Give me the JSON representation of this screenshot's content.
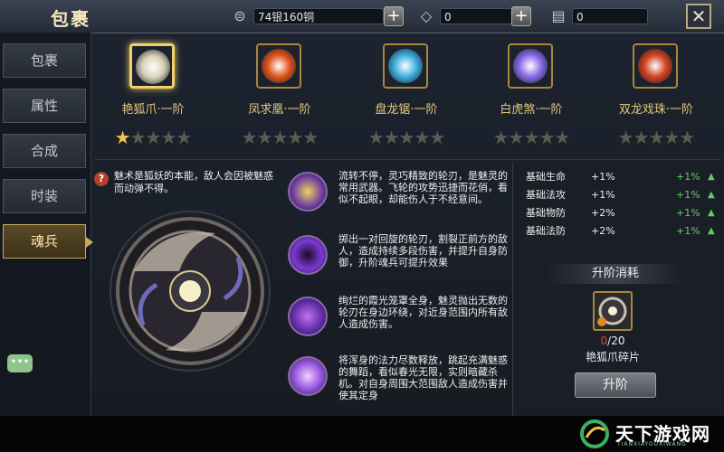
{
  "header": {
    "title": "包裹",
    "silver": "74银160铜",
    "gems": "0",
    "cards": "0"
  },
  "sidebar": {
    "items": [
      {
        "label": "包裹",
        "active": false
      },
      {
        "label": "属性",
        "active": false
      },
      {
        "label": "合成",
        "active": false
      },
      {
        "label": "时装",
        "active": false
      },
      {
        "label": "魂兵",
        "active": true
      }
    ]
  },
  "weapons": [
    {
      "name": "艳狐爪·一阶",
      "stars": 1,
      "selected": true,
      "color": "#d8d0b8"
    },
    {
      "name": "凤求凰·一阶",
      "stars": 0,
      "selected": false,
      "color": "#e0561d"
    },
    {
      "name": "盘龙锯·一阶",
      "stars": 0,
      "selected": false,
      "color": "#3fb0e0"
    },
    {
      "name": "白虎煞·一阶",
      "stars": 0,
      "selected": false,
      "color": "#8a6be8"
    },
    {
      "name": "双龙戏珠·一阶",
      "stars": 0,
      "selected": false,
      "color": "#d24422"
    }
  ],
  "description": "魅术是狐妖的本能，敌人会因被魅惑而动弹不得。",
  "skills": [
    {
      "text": "流转不停，灵巧精致的轮刃，是魅灵的常用武器。飞轮的攻势迅捷而花俏，看似不起眼，却能伤人于不经意间。"
    },
    {
      "text": "掷出一对回旋的轮刃，割裂正前方的敌人，造成持续多段伤害，并提升自身防御，升阶魂兵可提升效果"
    },
    {
      "text": "绚烂的霞光笼罩全身，魅灵抛出无数的轮刃在身边环绕，对近身范围内所有敌人造成伤害。"
    },
    {
      "text": "将浑身的法力尽数释放，跳起充满魅惑的舞蹈，看似春光无限，实则暗藏杀机。对自身周围大范围敌人造成伤害并使其定身"
    }
  ],
  "attributes": [
    {
      "name": "基础生命",
      "value": "+1%",
      "gain": "+1%"
    },
    {
      "name": "基础法攻",
      "value": "+1%",
      "gain": "+1%"
    },
    {
      "name": "基础物防",
      "value": "+2%",
      "gain": "+1%"
    },
    {
      "name": "基础法防",
      "value": "+2%",
      "gain": "+1%"
    }
  ],
  "upgrade": {
    "header": "升阶消耗",
    "fragment_current": "0",
    "fragment_total": "/20",
    "fragment_name": "艳狐爪碎片",
    "button": "升阶"
  },
  "logo": {
    "title": "天下游戏网",
    "sub": "TIANXIAYOUXIWANG"
  }
}
